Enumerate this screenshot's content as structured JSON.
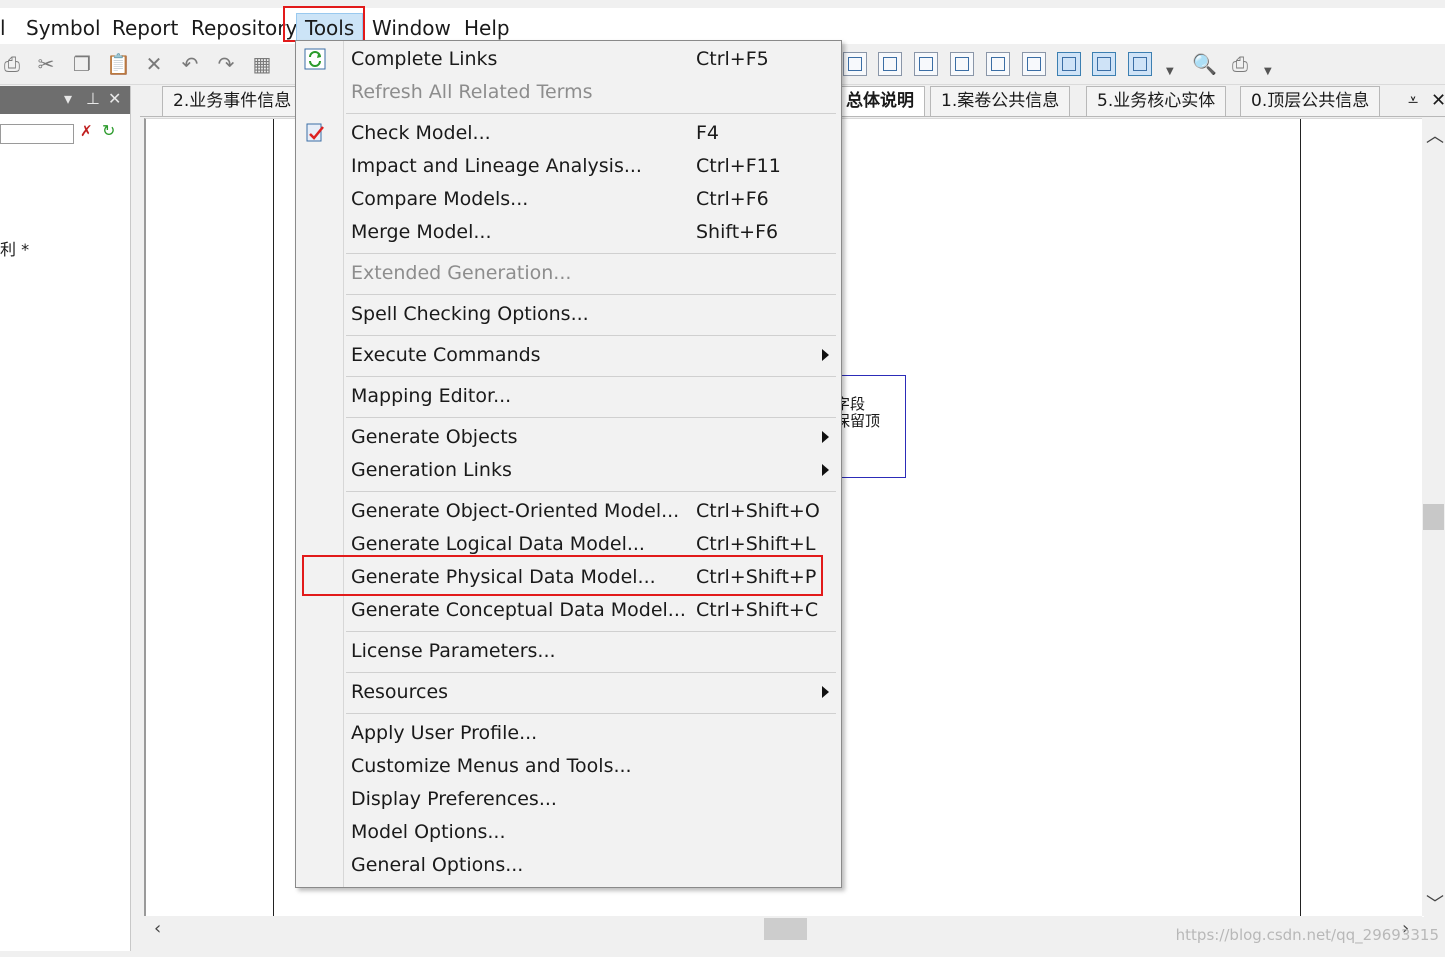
{
  "menubar": {
    "items": [
      "l",
      "Symbol",
      "Report",
      "Repository",
      "Tools",
      "Window",
      "Help"
    ],
    "active": "Tools"
  },
  "left_panel": {
    "tree_text": "利 *"
  },
  "tabs": [
    {
      "label": "2.业务事件信息"
    },
    {
      "label": "总体说明",
      "active": true
    },
    {
      "label": "1.案卷公共信息"
    },
    {
      "label": "5.业务核心实体"
    },
    {
      "label": "0.顶层公共信息"
    }
  ],
  "canvas": {
    "entity_lines": [
      "字段",
      "保留顶"
    ]
  },
  "tools_menu": {
    "groups": [
      [
        {
          "label": "Complete Links",
          "shortcut": "Ctrl+F5",
          "icon": "complete-links-icon"
        },
        {
          "label": "Refresh All Related Terms",
          "disabled": true
        }
      ],
      [
        {
          "label": "Check Model...",
          "shortcut": "F4",
          "icon": "check-model-icon"
        },
        {
          "label": "Impact and Lineage Analysis...",
          "shortcut": "Ctrl+F11"
        },
        {
          "label": "Compare Models...",
          "shortcut": "Ctrl+F6"
        },
        {
          "label": "Merge Model...",
          "shortcut": "Shift+F6"
        }
      ],
      [
        {
          "label": "Extended Generation...",
          "disabled": true
        }
      ],
      [
        {
          "label": "Spell Checking Options..."
        }
      ],
      [
        {
          "label": "Execute Commands",
          "submenu": true
        }
      ],
      [
        {
          "label": "Mapping Editor..."
        }
      ],
      [
        {
          "label": "Generate Objects",
          "submenu": true
        },
        {
          "label": "Generation Links",
          "submenu": true
        }
      ],
      [
        {
          "label": "Generate Object-Oriented Model...",
          "shortcut": "Ctrl+Shift+O"
        },
        {
          "label": "Generate Logical Data Model...",
          "shortcut": "Ctrl+Shift+L"
        },
        {
          "label": "Generate Physical Data Model...",
          "shortcut": "Ctrl+Shift+P",
          "highlighted": true
        },
        {
          "label": "Generate Conceptual Data Model...",
          "shortcut": "Ctrl+Shift+C"
        }
      ],
      [
        {
          "label": "License Parameters..."
        }
      ],
      [
        {
          "label": "Resources",
          "submenu": true
        }
      ],
      [
        {
          "label": "Apply User Profile..."
        },
        {
          "label": "Customize Menus and Tools..."
        },
        {
          "label": "Display Preferences..."
        },
        {
          "label": "Model Options..."
        },
        {
          "label": "General Options..."
        }
      ]
    ]
  },
  "watermark": "https://blog.csdn.net/qq_29693315",
  "colors": {
    "highlight_box": "#e21a1a",
    "active_menu_bg": "#cce4f7",
    "entity_border": "#2c2cb8"
  }
}
